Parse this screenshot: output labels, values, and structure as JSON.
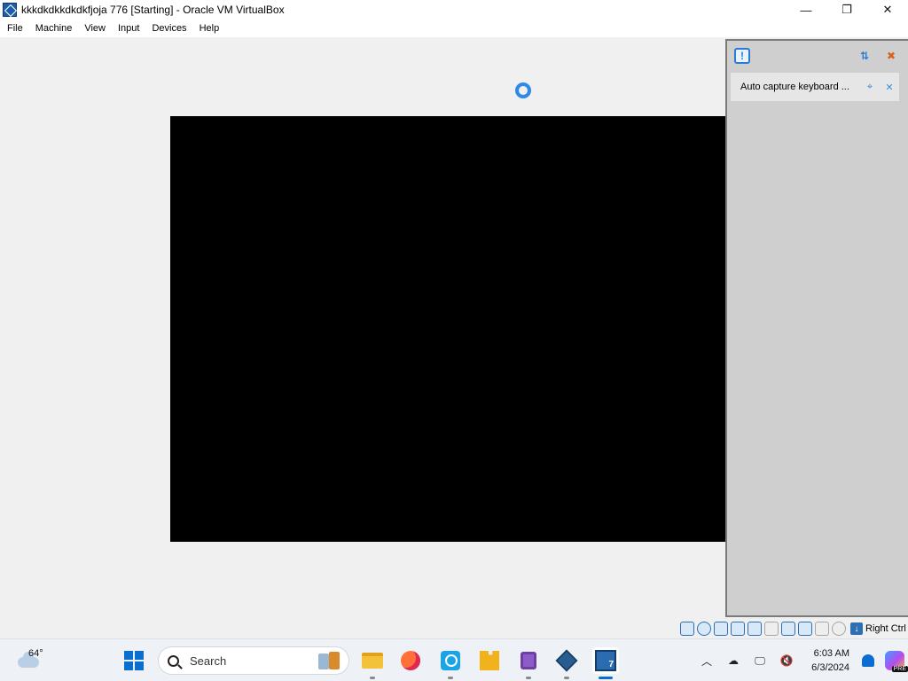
{
  "window": {
    "title": "kkkdkdkkdkdkfjoja 776 [Starting] - Oracle VM VirtualBox",
    "controls": {
      "minimize": "—",
      "maximize": "❐",
      "close": "✕"
    }
  },
  "menu": [
    "File",
    "Machine",
    "View",
    "Input",
    "Devices",
    "Help"
  ],
  "notifications": {
    "items": [
      {
        "text": "Auto capture keyboard ..."
      }
    ]
  },
  "statusbar": {
    "host_key": "Right Ctrl"
  },
  "taskbar": {
    "weather_temp": "64°",
    "search_placeholder": "Search",
    "apps": [
      "file-explorer",
      "firefox",
      "lens",
      "puzzle",
      "purple-app",
      "virtualbox",
      "vm-window"
    ],
    "active_app": "vm-window",
    "clock_time": "6:03 AM",
    "clock_date": "6/3/2024",
    "copilot_badge": "PRE"
  },
  "colors": {
    "accent": "#0a6ed1",
    "vm_screen": "#000000",
    "notif_panel": "#cfcfcf"
  }
}
